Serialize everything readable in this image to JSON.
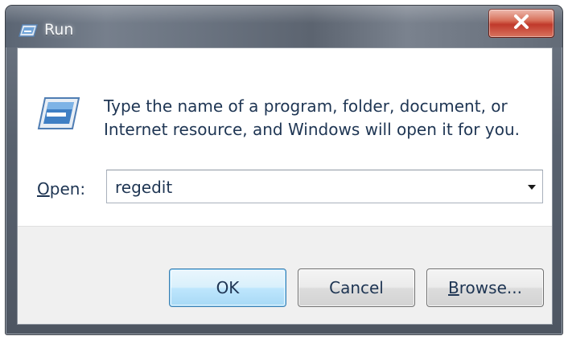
{
  "window": {
    "title": "Run",
    "close_label": "X"
  },
  "dialog": {
    "description_line1": "Type the name of a program, folder, document, or",
    "description_line2": "Internet resource, and Windows will open it for you.",
    "open_label_mnemonic": "O",
    "open_label_rest": "pen:",
    "open_value": "regedit"
  },
  "buttons": {
    "ok": "OK",
    "cancel": "Cancel",
    "browse_mnemonic": "B",
    "browse_rest": "rowse..."
  },
  "icons": {
    "title": "run-icon",
    "close": "close-icon",
    "dialog": "run-icon",
    "dropdown": "chevron-down-icon"
  },
  "colors": {
    "close_button": "#c0392b",
    "text": "#1e3553",
    "ok_button": "#bee6fd"
  }
}
